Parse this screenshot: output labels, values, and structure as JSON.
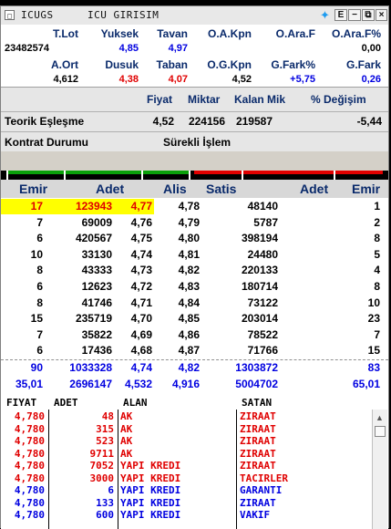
{
  "window": {
    "symbol": "ICUGS",
    "title": "ICU GIRISIM",
    "buttons": [
      "E",
      "−",
      "⧉",
      "×"
    ],
    "icon_names": [
      "menu-icon",
      "twitter-icon",
      "minimize-icon",
      "restore-icon",
      "close-icon"
    ]
  },
  "summary": {
    "row1_labels": [
      "T.Lot",
      "Yuksek",
      "Tavan",
      "O.A.Kpn",
      "O.Ara.F",
      "O.Ara.F%"
    ],
    "row1_values": [
      "23482574",
      "4,85",
      "4,97",
      "",
      "",
      "0,00"
    ],
    "row2_labels": [
      "A.Ort",
      "Dusuk",
      "Taban",
      "O.G.Kpn",
      "G.Fark%",
      "G.Fark"
    ],
    "row2_values": [
      "4,612",
      "4,38",
      "4,07",
      "4,52",
      "+5,75",
      "0,26"
    ]
  },
  "match": {
    "headers": [
      "Fiyat",
      "Miktar",
      "Kalan Mik",
      "% Değişim"
    ],
    "label": "Teorik Eşleşme",
    "fiyat": "4,52",
    "miktar": "224156",
    "kalan": "219587",
    "degisim": "-5,44",
    "contract_label": "Kontrat Durumu",
    "contract_value": "Sürekli İşlem"
  },
  "depth": {
    "headers": [
      "Emir",
      "Adet",
      "Alis",
      "Satis",
      "Adet",
      "Emir"
    ],
    "rows": [
      [
        "17",
        "123943",
        "4,77",
        "4,78",
        "48140",
        "1"
      ],
      [
        "7",
        "69009",
        "4,76",
        "4,79",
        "5787",
        "2"
      ],
      [
        "6",
        "420567",
        "4,75",
        "4,80",
        "398194",
        "8"
      ],
      [
        "10",
        "33130",
        "4,74",
        "4,81",
        "24480",
        "5"
      ],
      [
        "8",
        "43333",
        "4,73",
        "4,82",
        "220133",
        "4"
      ],
      [
        "6",
        "12623",
        "4,72",
        "4,83",
        "180714",
        "8"
      ],
      [
        "8",
        "41746",
        "4,71",
        "4,84",
        "73122",
        "10"
      ],
      [
        "15",
        "235719",
        "4,70",
        "4,85",
        "203014",
        "23"
      ],
      [
        "7",
        "35822",
        "4,69",
        "4,86",
        "78522",
        "7"
      ],
      [
        "6",
        "17436",
        "4,68",
        "4,87",
        "71766",
        "15"
      ]
    ],
    "totals1": [
      "90",
      "1033328",
      "4,74",
      "4,82",
      "1303872",
      "83"
    ],
    "totals2": [
      "35,01",
      "2696147",
      "4,532",
      "4,916",
      "5004702",
      "65,01"
    ],
    "highlight_color": "#ffff00",
    "highlight_text_color": "#e00000",
    "totals_color": "#0000e0"
  },
  "trades": {
    "headers": [
      "FIYAT",
      "ADET",
      "ALAN",
      "SATAN"
    ],
    "rows": [
      [
        "4,780",
        "48",
        "AK",
        "ZIRAAT"
      ],
      [
        "4,780",
        "315",
        "AK",
        "ZIRAAT"
      ],
      [
        "4,780",
        "523",
        "AK",
        "ZIRAAT"
      ],
      [
        "4,780",
        "9711",
        "AK",
        "ZIRAAT"
      ],
      [
        "4,780",
        "7052",
        "YAPI KREDI",
        "ZIRAAT"
      ],
      [
        "4,780",
        "3000",
        "YAPI KREDI",
        "TACIRLER"
      ],
      [
        "4,780",
        "6",
        "YAPI KREDI",
        "GARANTI"
      ],
      [
        "4,780",
        "133",
        "YAPI KREDI",
        "ZIRAAT"
      ],
      [
        "4,780",
        "600",
        "YAPI KREDI",
        "VAKIF"
      ]
    ],
    "red": "#e00000",
    "blue": "#0000e0"
  }
}
